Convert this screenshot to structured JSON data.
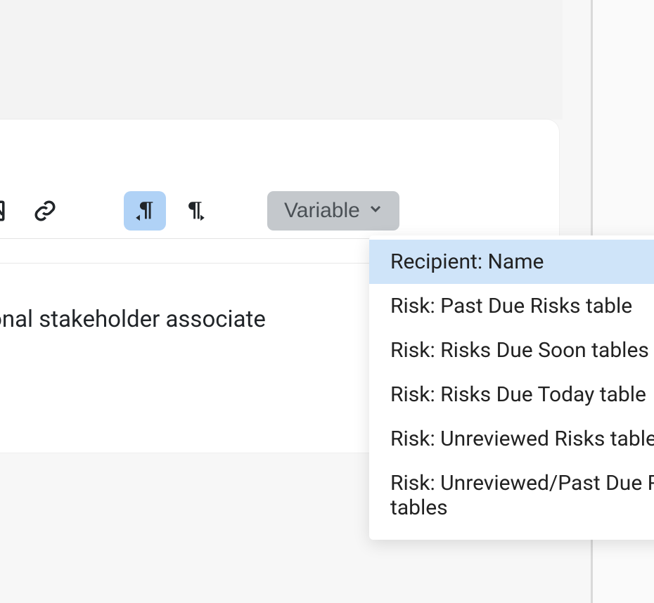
{
  "toolbar": {
    "variable_label": "Variable"
  },
  "dropdown": {
    "items": [
      "Recipient: Name",
      "Risk: Past Due Risks table",
      "Risk: Risks Due Soon tables",
      "Risk: Risks Due Today table",
      "Risk: Unreviewed Risks table",
      "Risk: Unreviewed/Past Due Risks tables"
    ]
  },
  "body": {
    "text": "dditional stakeholder associate"
  }
}
